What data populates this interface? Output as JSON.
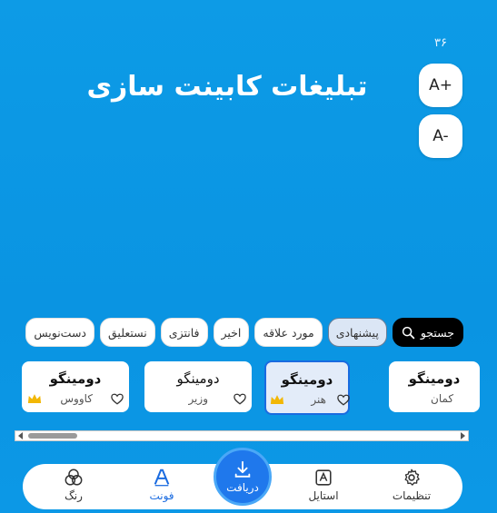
{
  "size": {
    "count": "۳۶",
    "increase_label": "A+",
    "decrease_label": "A-"
  },
  "preview": {
    "text": "تبلیغات کابینت سازی"
  },
  "chips": [
    {
      "label": "جستجو",
      "type": "search"
    },
    {
      "label": "پیشنهادی",
      "active": true
    },
    {
      "label": "مورد علاقه"
    },
    {
      "label": "اخیر"
    },
    {
      "label": "فانتزی"
    },
    {
      "label": "نستعلیق"
    },
    {
      "label": "دست‌نویس"
    }
  ],
  "cards": [
    {
      "name": "دومینگو",
      "label": "کمان",
      "crown": false
    },
    {
      "name": "دومینگو",
      "label": "هنر",
      "crown": true,
      "selected": true
    },
    {
      "name": "دومینگو",
      "label": "وزیر",
      "crown": false
    },
    {
      "name": "دومینگو",
      "label": "کاووس",
      "crown": true
    }
  ],
  "nav": {
    "settings": "تنظیمات",
    "style": "استایل",
    "download": "دریافت",
    "font": "فونت",
    "color": "رنگ"
  },
  "colors": {
    "accent": "#1a6be0",
    "background": "#0d9be6",
    "crown": "#f2b705"
  }
}
